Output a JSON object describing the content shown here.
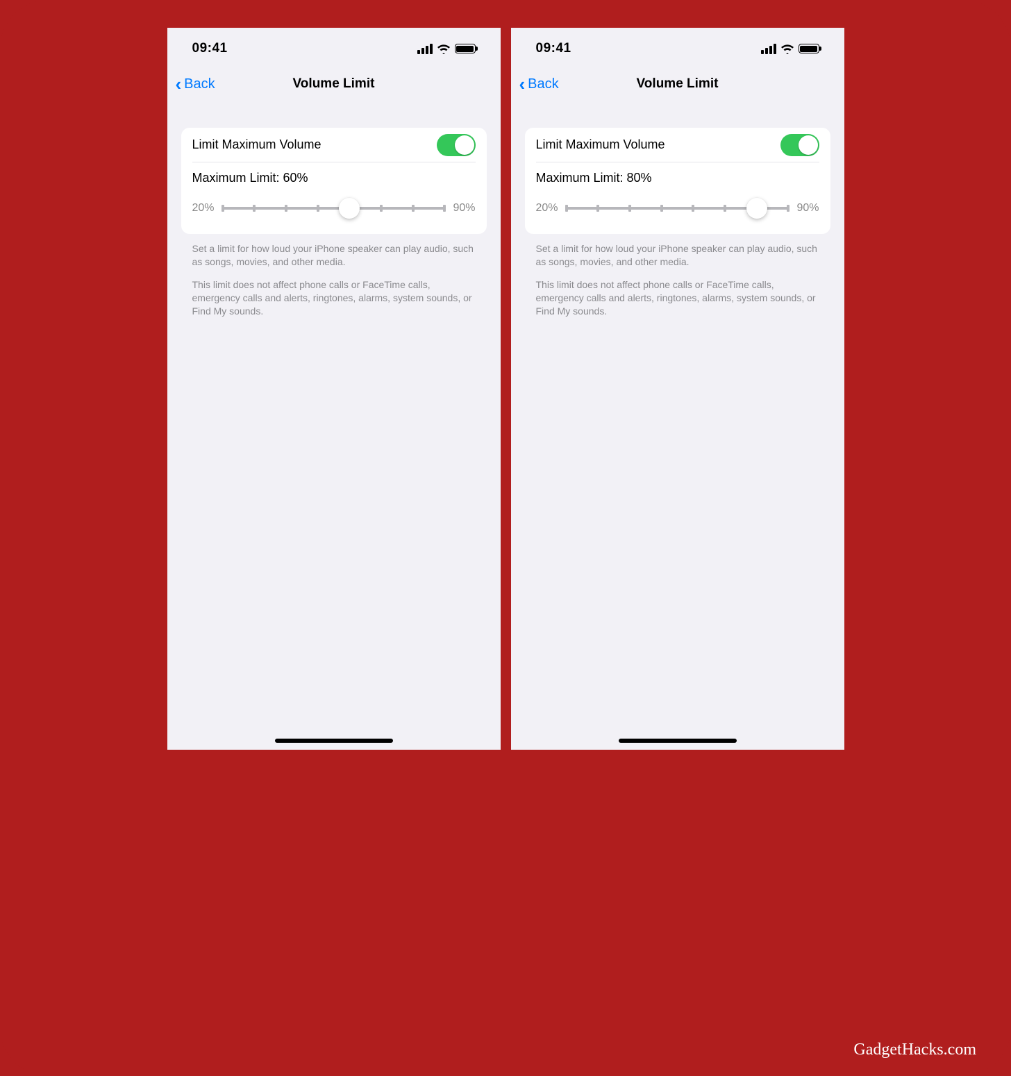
{
  "credit": "GadgetHacks.com",
  "screens": [
    {
      "statusbar": {
        "time": "09:41"
      },
      "nav": {
        "back": "Back",
        "title": "Volume Limit"
      },
      "toggle_label": "Limit Maximum Volume",
      "toggle_on": true,
      "max_label": "Maximum Limit: 60%",
      "slider": {
        "min_label": "20%",
        "max_label": "90%",
        "min": 20,
        "max": 90,
        "step": 10,
        "value": 60,
        "ticks": [
          20,
          30,
          40,
          50,
          60,
          70,
          80,
          90
        ]
      },
      "footer": {
        "p1": "Set a limit for how loud your iPhone speaker can play audio, such as songs, movies, and other media.",
        "p2": "This limit does not affect phone calls or FaceTime calls, emergency calls and alerts, ringtones, alarms, system sounds, or Find My sounds."
      }
    },
    {
      "statusbar": {
        "time": "09:41"
      },
      "nav": {
        "back": "Back",
        "title": "Volume Limit"
      },
      "toggle_label": "Limit Maximum Volume",
      "toggle_on": true,
      "max_label": "Maximum Limit: 80%",
      "slider": {
        "min_label": "20%",
        "max_label": "90%",
        "min": 20,
        "max": 90,
        "step": 10,
        "value": 80,
        "ticks": [
          20,
          30,
          40,
          50,
          60,
          70,
          80,
          90
        ]
      },
      "footer": {
        "p1": "Set a limit for how loud your iPhone speaker can play audio, such as songs, movies, and other media.",
        "p2": "This limit does not affect phone calls or FaceTime calls, emergency calls and alerts, ringtones, alarms, system sounds, or Find My sounds."
      }
    }
  ]
}
